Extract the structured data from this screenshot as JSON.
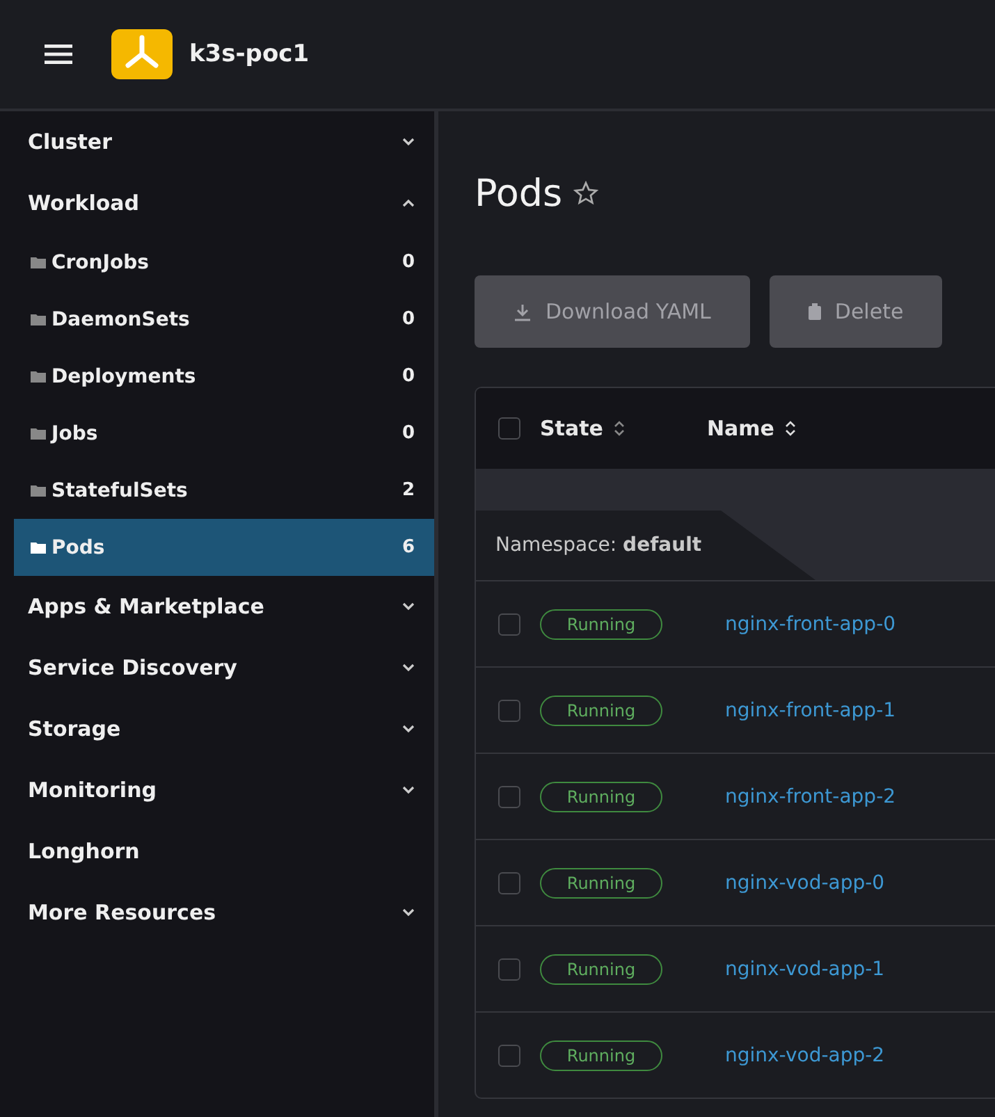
{
  "header": {
    "cluster_name": "k3s-poc1"
  },
  "sidebar": {
    "items": [
      {
        "kind": "group",
        "label": "Cluster",
        "expanded": false
      },
      {
        "kind": "group",
        "label": "Workload",
        "expanded": true,
        "children": [
          {
            "label": "CronJobs",
            "count": "0",
            "selected": false
          },
          {
            "label": "DaemonSets",
            "count": "0",
            "selected": false
          },
          {
            "label": "Deployments",
            "count": "0",
            "selected": false
          },
          {
            "label": "Jobs",
            "count": "0",
            "selected": false
          },
          {
            "label": "StatefulSets",
            "count": "2",
            "selected": false
          },
          {
            "label": "Pods",
            "count": "6",
            "selected": true
          }
        ]
      },
      {
        "kind": "group",
        "label": "Apps & Marketplace",
        "expanded": false
      },
      {
        "kind": "group",
        "label": "Service Discovery",
        "expanded": false
      },
      {
        "kind": "group",
        "label": "Storage",
        "expanded": false
      },
      {
        "kind": "group",
        "label": "Monitoring",
        "expanded": false
      },
      {
        "kind": "link",
        "label": "Longhorn"
      },
      {
        "kind": "group",
        "label": "More Resources",
        "expanded": false
      }
    ]
  },
  "page": {
    "title": "Pods",
    "favorite": false
  },
  "actions": [
    {
      "label": "Download YAML",
      "kind": "download",
      "disabled": true
    },
    {
      "label": "Delete",
      "kind": "delete",
      "disabled": true
    }
  ],
  "table": {
    "select_all": {
      "checked": false
    },
    "columns": [
      "State",
      "Name"
    ],
    "group_label": "Namespace: **default**",
    "rows": [
      {
        "checked": false,
        "state": "Running",
        "name": "nginx-front-app-0"
      },
      {
        "checked": false,
        "state": "Running",
        "name": "nginx-front-app-1"
      },
      {
        "checked": false,
        "state": "Running",
        "name": "nginx-front-app-2"
      },
      {
        "checked": false,
        "state": "Running",
        "name": "nginx-vod-app-0"
      },
      {
        "checked": false,
        "state": "Running",
        "name": "nginx-vod-app-1"
      },
      {
        "checked": false,
        "state": "Running",
        "name": "nginx-vod-app-2"
      }
    ]
  }
}
